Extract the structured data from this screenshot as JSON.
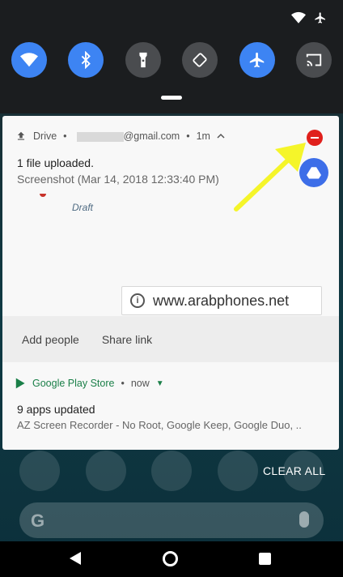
{
  "colors": {
    "tile_on": "#3d84f3",
    "tile_off": "#4a4c4f",
    "play_green": "#1a7f48",
    "close_red": "#e0201c",
    "arrow_yellow": "#f5f52a"
  },
  "status_icons": [
    "wifi-icon",
    "airplane-icon"
  ],
  "quick_tiles": [
    {
      "icon": "wifi-icon",
      "state": "on"
    },
    {
      "icon": "bluetooth-icon",
      "state": "on"
    },
    {
      "icon": "flashlight-icon",
      "state": "off"
    },
    {
      "icon": "auto-rotate-icon",
      "state": "off"
    },
    {
      "icon": "airplane-icon",
      "state": "on"
    },
    {
      "icon": "cast-icon",
      "state": "off"
    }
  ],
  "drive_notification": {
    "app": "Drive",
    "account_suffix": "@gmail.com",
    "time": "1m",
    "title": "1 file uploaded.",
    "subtitle": "Screenshot (Mar 14, 2018 12:33:40 PM)",
    "draft_label": "Draft",
    "actions": [
      "Add people",
      "Share link"
    ]
  },
  "watermark": {
    "text": "www.arabphones.net"
  },
  "play_notification": {
    "app": "Google Play Store",
    "time": "now",
    "title": "9 apps updated",
    "subtitle": "AZ Screen Recorder - No Root, Google Keep, Google Duo, .."
  },
  "clear_all": "CLEAR ALL",
  "search": {
    "logo": "G"
  }
}
